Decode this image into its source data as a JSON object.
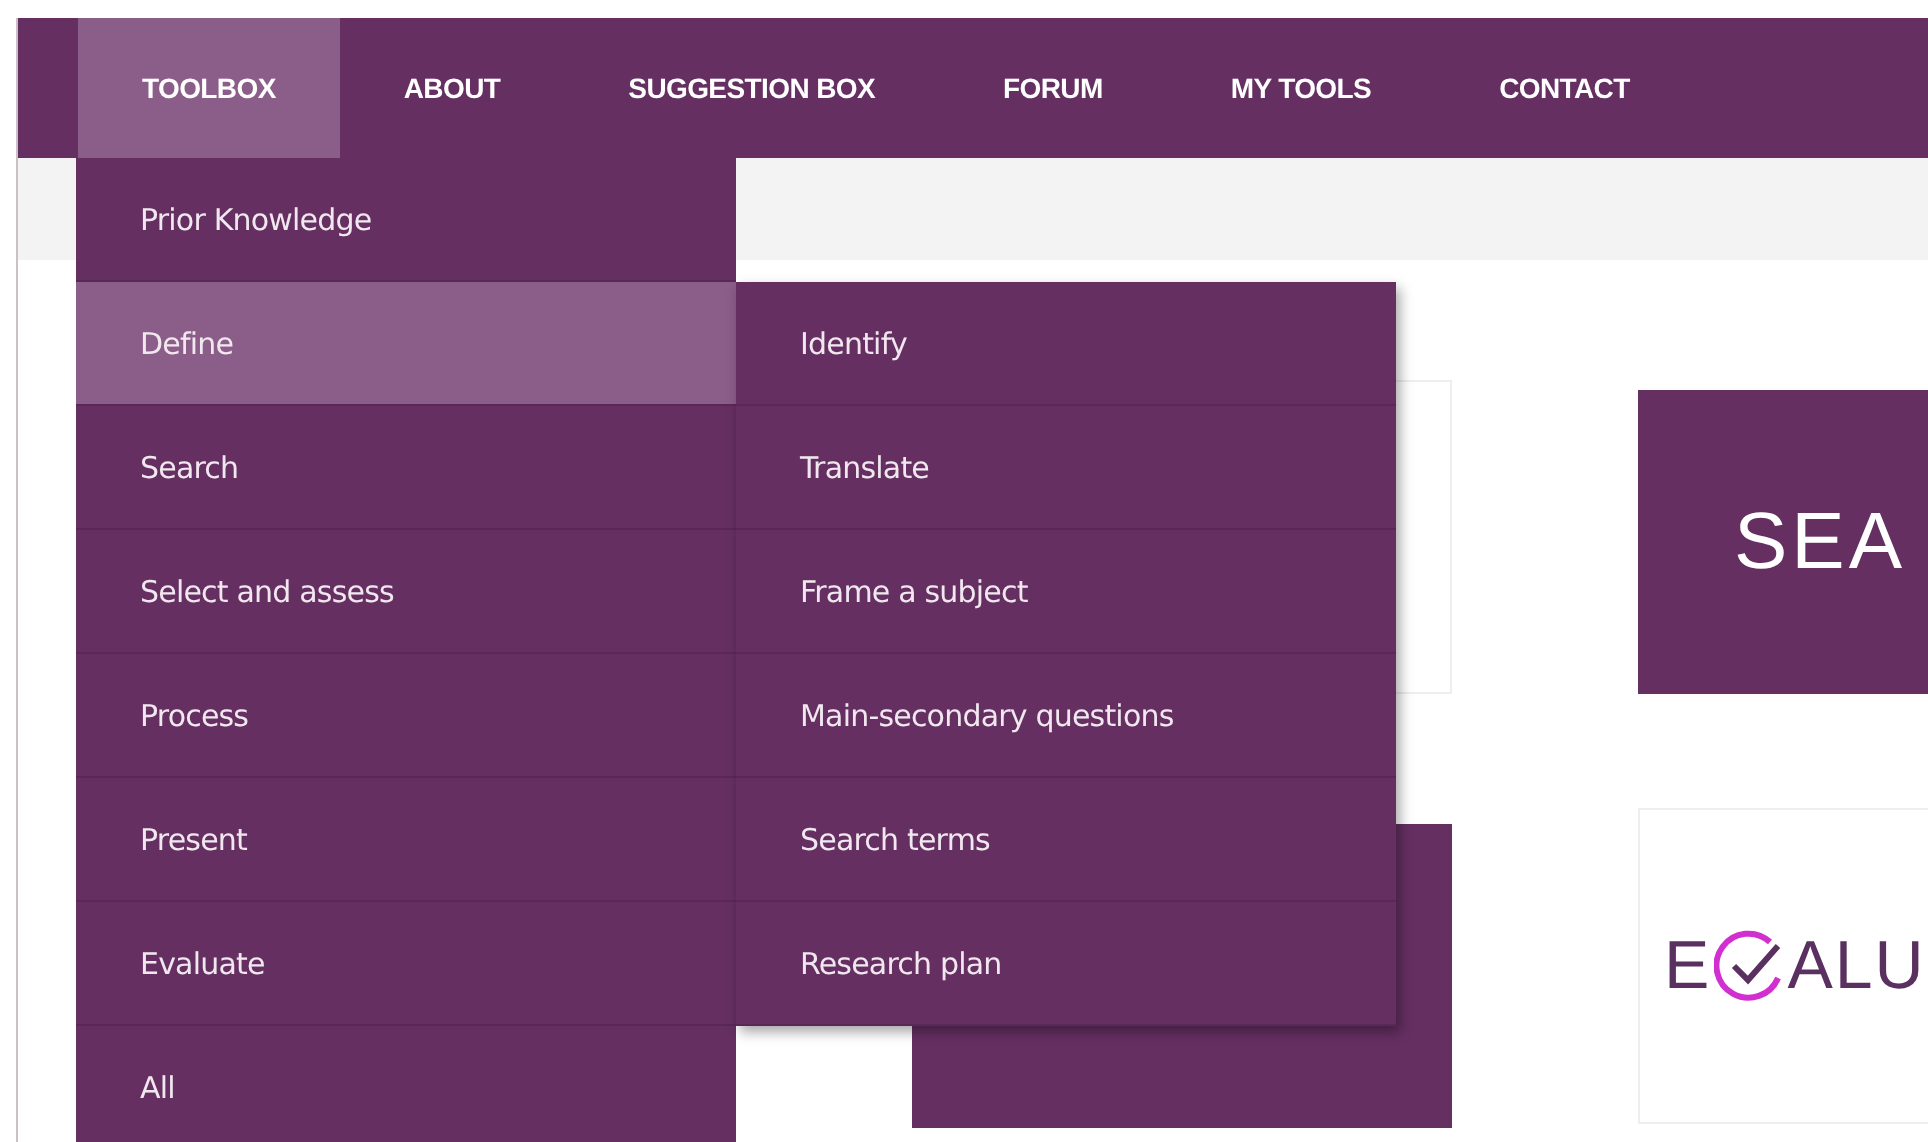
{
  "nav": [
    {
      "label": "TOOLBOX",
      "selected": true
    },
    {
      "label": "ABOUT",
      "selected": false
    },
    {
      "label": "SUGGESTION BOX",
      "selected": false
    },
    {
      "label": "FORUM",
      "selected": false
    },
    {
      "label": "MY TOOLS",
      "selected": false
    },
    {
      "label": "CONTACT",
      "selected": false
    }
  ],
  "menu": {
    "items": [
      {
        "label": "Prior Knowledge",
        "selected": false
      },
      {
        "label": "Define",
        "selected": true
      },
      {
        "label": "Search",
        "selected": false
      },
      {
        "label": "Select and assess",
        "selected": false
      },
      {
        "label": "Process",
        "selected": false
      },
      {
        "label": "Present",
        "selected": false
      },
      {
        "label": "Evaluate",
        "selected": false
      },
      {
        "label": "All",
        "selected": false
      }
    ],
    "submenu": [
      "Identify",
      "Translate",
      "Frame a subject",
      "Main-secondary questions",
      "Search terms",
      "Research plan"
    ]
  },
  "cards": [
    {
      "kind": "outline"
    },
    {
      "kind": "banner",
      "text": "SEA"
    },
    {
      "kind": "solid"
    },
    {
      "kind": "logo",
      "text_start": "E",
      "text_end": "ALU"
    }
  ]
}
